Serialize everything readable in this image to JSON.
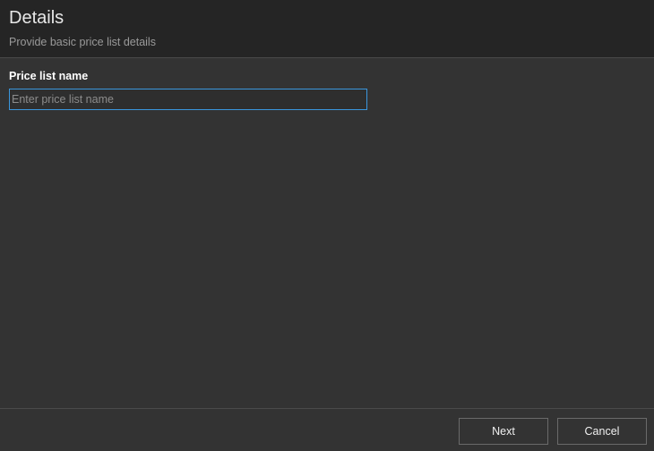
{
  "header": {
    "title": "Details",
    "subtitle": "Provide basic price list details"
  },
  "form": {
    "price_list_name": {
      "label": "Price list name",
      "value": "",
      "placeholder": "Enter price list name"
    }
  },
  "footer": {
    "next_label": "Next",
    "cancel_label": "Cancel"
  },
  "colors": {
    "background": "#333333",
    "header_background": "#252525",
    "accent_focus_border": "#3a96dd"
  }
}
